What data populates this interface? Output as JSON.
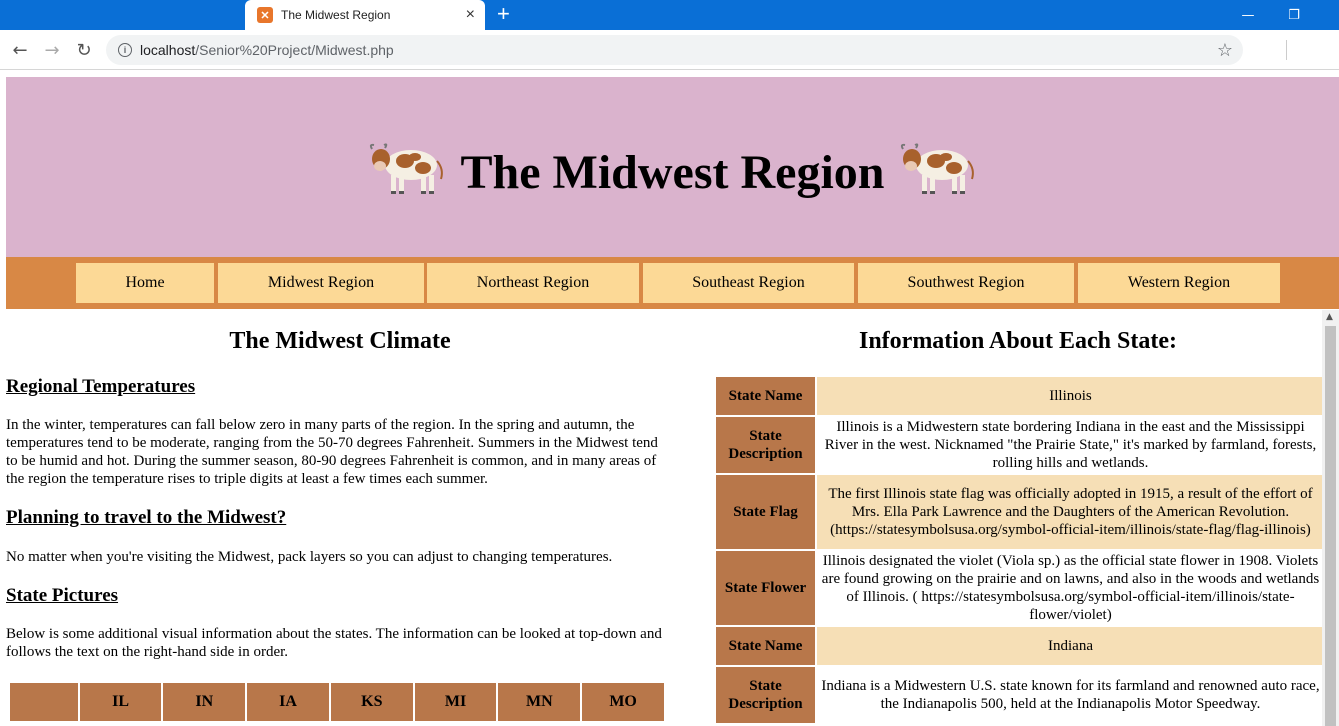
{
  "browser": {
    "tab_title": "The Midwest Region",
    "tab_close": "×",
    "new_tab": "+",
    "url_host": "localhost",
    "url_path": "/Senior%20Project/Midwest.php",
    "back": "←",
    "forward": "→",
    "reload": "↻",
    "star": "☆",
    "minimize": "—",
    "restore": "❐",
    "close": "✕"
  },
  "banner": {
    "title": "The Midwest Region"
  },
  "nav": {
    "items": [
      {
        "label": "Home"
      },
      {
        "label": "Midwest Region"
      },
      {
        "label": "Northeast Region"
      },
      {
        "label": "Southeast Region"
      },
      {
        "label": "Southwest Region"
      },
      {
        "label": "Western Region"
      }
    ]
  },
  "left": {
    "heading": "The Midwest Climate",
    "sections": [
      {
        "title": "Regional Temperatures",
        "text": "In the winter, temperatures can fall below zero in many parts of the region. In the spring and autumn, the temperatures tend to be moderate, ranging from the 50-70 degrees Fahrenheit. Summers in the Midwest tend to be humid and hot. During the summer season, 80-90 degrees Fahrenheit is common, and in many areas of the region the temperature rises to triple digits at least a few times each summer."
      },
      {
        "title": "Planning to travel to the Midwest?",
        "text": "No matter when you're visiting the Midwest, pack layers so you can adjust to changing temperatures."
      },
      {
        "title": "State Pictures",
        "text": "Below is some additional visual information about the states. The information can be looked at top-down and follows the text on the right-hand side in order."
      }
    ],
    "pictures_headers": [
      "",
      "IL",
      "IN",
      "IA",
      "KS",
      "MI",
      "MN",
      "MO"
    ]
  },
  "right": {
    "heading": "Information About Each State:",
    "rows": [
      {
        "label": "State Name",
        "value": "Illinois"
      },
      {
        "label": "State Description",
        "value": "Illinois is a Midwestern state bordering Indiana in the east and the Mississippi River in the west. Nicknamed \"the Prairie State,\" it's marked by farmland, forests, rolling hills and wetlands."
      },
      {
        "label": "State Flag",
        "value": "The first Illinois state flag was officially adopted in 1915, a result of the effort of Mrs. Ella Park Lawrence and the Daughters of the American Revolution. (https://statesymbolsusa.org/symbol-official-item/illinois/state-flag/flag-illinois)"
      },
      {
        "label": "State Flower",
        "value": "Illinois designated the violet (Viola sp.) as the official state flower in 1908. Violets are found growing on the prairie and on lawns, and also in the woods and wetlands of Illinois. ( https://statesymbolsusa.org/symbol-official-item/illinois/state-flower/violet)"
      },
      {
        "label": "State Name",
        "value": "Indiana"
      },
      {
        "label": "State Description",
        "value": "Indiana is a Midwestern U.S. state known for its farmland and renowned auto race, the Indianapolis 500, held at the Indianapolis Motor Speedway."
      }
    ]
  }
}
